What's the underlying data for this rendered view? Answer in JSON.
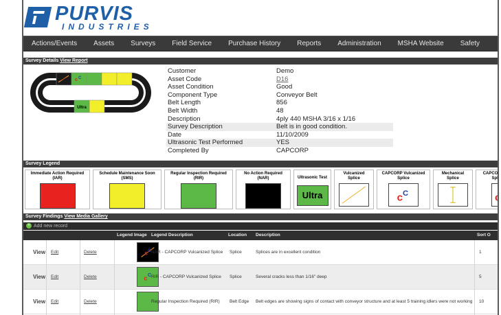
{
  "brand": {
    "name": "PURVIS",
    "sub": "INDUSTRIES",
    "color": "#1f5fa8"
  },
  "nav": {
    "items": [
      "Actions/Events",
      "Assets",
      "Surveys",
      "Field Service",
      "Purchase History",
      "Reports",
      "Administration",
      "MSHA Website",
      "Safety"
    ]
  },
  "survey_details": {
    "title": "Survey Details",
    "link": "View Report",
    "track_label": "Ultra",
    "fields": [
      {
        "key": "Customer",
        "value": "Demo"
      },
      {
        "key": "Asset Code",
        "value": "D16"
      },
      {
        "key": "Asset Condition",
        "value": "Good"
      },
      {
        "key": "Component Type",
        "value": "Conveyor Belt"
      },
      {
        "key": "Belt Length",
        "value": "856"
      },
      {
        "key": "Belt Width",
        "value": "48"
      },
      {
        "key": "Description",
        "value": "4ply 440 MSHA 3/16 x 1/16"
      },
      {
        "key": "Survey Description",
        "value": "Belt is in good condition."
      },
      {
        "key": "Date",
        "value": "11/10/2009"
      },
      {
        "key": "Ultrasonic Test Performed",
        "value": "YES"
      },
      {
        "key": "Completed By",
        "value": "CAPCORP"
      }
    ]
  },
  "legend": {
    "title": "Survey Legend",
    "items": [
      {
        "label": "Immediate Action Required\n(IAR)",
        "color": "#e8231f"
      },
      {
        "label": "Schedule Maintenance Soon\n(SMS)",
        "color": "#f2ee2a"
      },
      {
        "label": "Regular Inspection Required\n(RIR)",
        "color": "#5cb947"
      },
      {
        "label": "No Action Required\n(NAR)",
        "color": "#000000"
      },
      {
        "label": "Ultrasonic Test",
        "color": "#5cb947",
        "text": "Ultra"
      },
      {
        "label": "Vulcanized\nSplice",
        "color": "#ffffff"
      },
      {
        "label": "CAPCORP Vulcanized\nSplice",
        "color": "#ffffff"
      },
      {
        "label": "Mechanical\nSplice",
        "color": "#ffffff"
      },
      {
        "label": "CAPCORP M\nSpli",
        "color": "#ffffff"
      }
    ]
  },
  "findings": {
    "title": "Survey Findings",
    "link": "View Media Gallery",
    "add_label": "Add new record",
    "headers": [
      "Legend Image",
      "Legend Description",
      "Location",
      "Description",
      "Sort O"
    ],
    "rows": [
      {
        "view": "View",
        "edit": "Edit",
        "delete": "Delete",
        "image": "black",
        "legend": "NAR - CAPCORP Vulcanized Splice",
        "location": "Splice",
        "description": "Splices are in excellent condition",
        "sort": "1"
      },
      {
        "view": "View",
        "edit": "Edit",
        "delete": "Delete",
        "image": "green-splice",
        "legend": "RIR - CAPCORP Vulcanized Splice",
        "location": "Splice",
        "description": "Several cracks less than 1/16\" deep",
        "sort": "5"
      },
      {
        "view": "View",
        "edit": "Edit",
        "delete": "Delete",
        "image": "green",
        "legend": "Regular Inspection Required (RIR)",
        "location": "Belt Edge",
        "description": "Belt edges are showing signs of contact with conveyor structure and at least 5 training idlers were not working",
        "sort": "10"
      }
    ]
  }
}
